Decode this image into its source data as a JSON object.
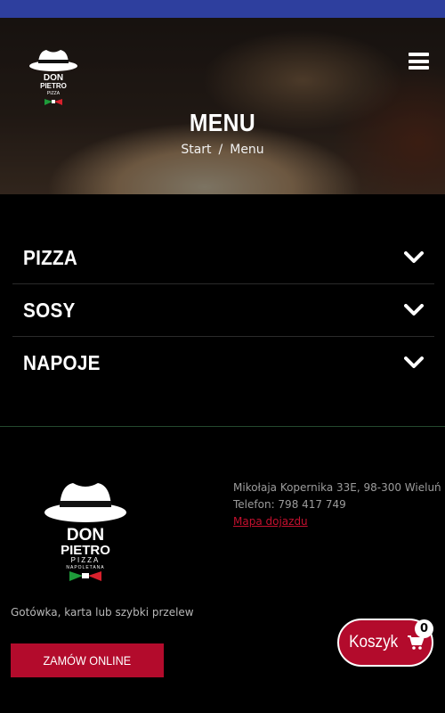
{
  "hero": {
    "title": "MENU",
    "breadcrumb": [
      "Start",
      "Menu"
    ],
    "breadcrumb_separator": "/"
  },
  "logo": {
    "line1": "DON",
    "line2": "PIETRO",
    "line3": "PIZZA",
    "line4": "NAPOLETANA"
  },
  "menu": {
    "categories": [
      {
        "label": "PIZZA"
      },
      {
        "label": "SOSY"
      },
      {
        "label": "NAPOJE"
      }
    ]
  },
  "footer": {
    "address": "Mikołaja Kopernika 33E, 98-300 Wieluń",
    "phone": "Telefon: 798 417 749",
    "map_link": "Mapa dojazdu",
    "payment": "Gotówka, karta lub szybki przelew",
    "order_button": "ZAMÓW ONLINE"
  },
  "cart": {
    "label": "Koszyk",
    "count": "0",
    "icon": "shopping-cart-icon"
  },
  "colors": {
    "accent": "#b30b2c",
    "status_bar": "#2e3f9e",
    "background": "#000000"
  }
}
